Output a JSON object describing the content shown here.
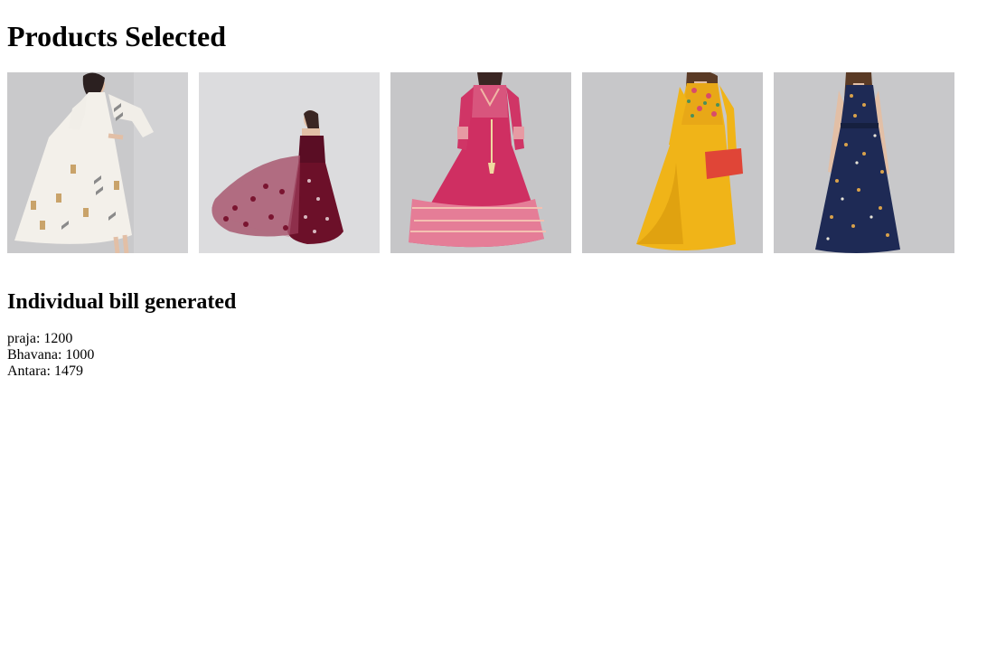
{
  "page": {
    "title": "Products Selected",
    "bill_heading": "Individual bill generated"
  },
  "products": [
    {
      "image": "woman-white-printed-anarkali-dress",
      "bg": "#c9c9cb",
      "dress": "#f3f0ea",
      "accent": "#b9905a"
    },
    {
      "image": "woman-maroon-net-gown",
      "bg": "#dcdcde",
      "dress": "#7d1535",
      "accent": "#c89aa5"
    },
    {
      "image": "woman-pink-printed-anarkali-kurta",
      "bg": "#c6c6c8",
      "dress": "#cf2f62",
      "accent": "#e8a6a0"
    },
    {
      "image": "woman-yellow-embroidered-dress-red-clutch",
      "bg": "#c7c7c9",
      "dress": "#f0b418",
      "accent": "#e04537"
    },
    {
      "image": "woman-navy-floral-sleeveless-dress",
      "bg": "#c8c8ca",
      "dress": "#1e2a55",
      "accent": "#d9a24b"
    }
  ],
  "bills": [
    {
      "name": "praja",
      "amount": "1200",
      "text": "praja: 1200"
    },
    {
      "name": "Bhavana",
      "amount": "1000",
      "text": "Bhavana: 1000"
    },
    {
      "name": "Antara",
      "amount": "1479",
      "text": "Antara: 1479"
    }
  ]
}
